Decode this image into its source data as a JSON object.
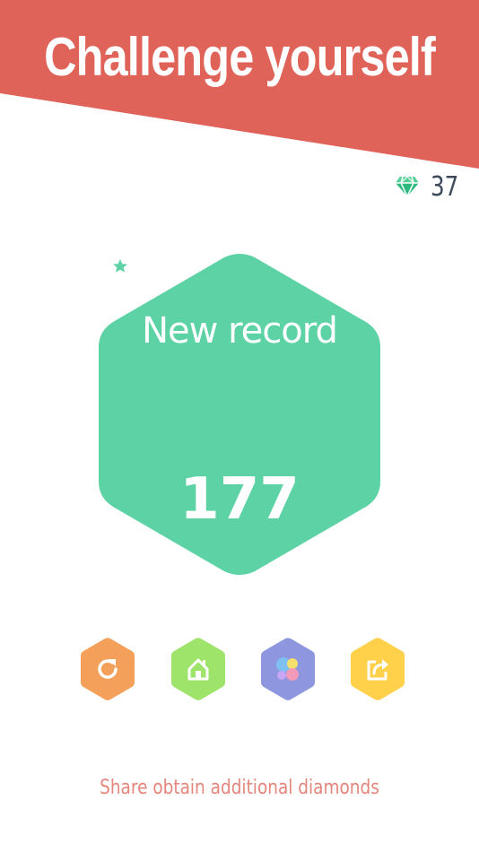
{
  "header": {
    "title": "Challenge yourself"
  },
  "diamonds": {
    "count": "37",
    "icon": "diamond-icon",
    "color": "#2db87d"
  },
  "result": {
    "label": "New record",
    "icon": "trophy-icon",
    "score": "177",
    "color": "#5dd3a5"
  },
  "actions": [
    {
      "name": "replay",
      "icon": "replay-icon",
      "color": "#f5a05a"
    },
    {
      "name": "home",
      "icon": "home-icon",
      "color": "#9ee36a"
    },
    {
      "name": "game-center",
      "icon": "game-center-icon",
      "color": "#8e96e0"
    },
    {
      "name": "share",
      "icon": "share-icon",
      "color": "#ffd04a"
    }
  ],
  "footer": {
    "share_hint": "Share obtain additional diamonds"
  },
  "theme": {
    "banner": "#e0635a",
    "text_dark": "#3d4a5c",
    "hint": "#e4867c"
  }
}
